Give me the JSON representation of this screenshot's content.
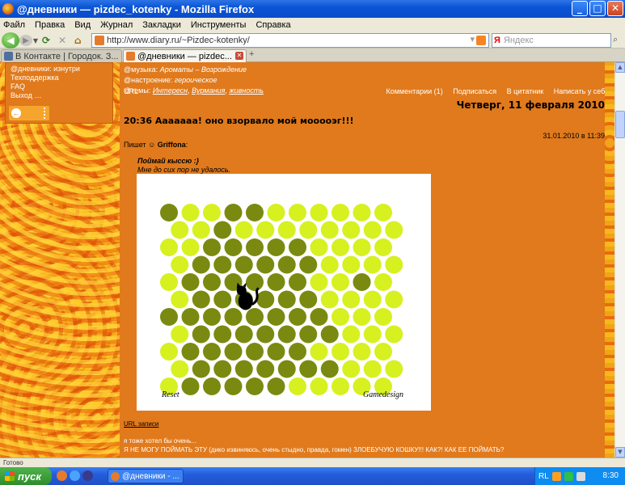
{
  "window": {
    "title": "@дневники — pizdec_kotenky - Mozilla Firefox",
    "min": "_",
    "max": "□",
    "close": "✕"
  },
  "menu": {
    "items": [
      "Файл",
      "Правка",
      "Вид",
      "Журнал",
      "Закладки",
      "Инструменты",
      "Справка"
    ]
  },
  "nav": {
    "url": "http://www.diary.ru/~Pizdec-kotenky/",
    "search_placeholder": "Яндекс",
    "search_engine": "Я"
  },
  "tabs": [
    {
      "label": "В Контакте | Городок. З..."
    },
    {
      "label": "@дневники — pizdec..."
    }
  ],
  "sidebar": {
    "items": [
      "@дневники: изнутри",
      "Техподдержка",
      "FAQ",
      "Выход"
    ],
    "exit_suffix": "…"
  },
  "post": {
    "meta_music_label": "@музыка:",
    "meta_music": "Ароматы – Возрождение",
    "meta_mood_label": "@настроение:",
    "meta_mood": "героическое",
    "meta_topics_label": "@темы:",
    "meta_topics": [
      "Интересн",
      "Вурмания",
      "живность"
    ],
    "url_label": "URL",
    "comments": "Комментарии (1)",
    "subscribe": "Подписаться",
    "quote": "В цитатник",
    "write_to_self": "Написать у себя",
    "date": "Четверг, 11 февраля 2010",
    "title": "20:36 Ааааааа! оно взорвало мой мооооэг!!!",
    "timestamp": "31.01.2010 в 11:39",
    "author_label": "Пишет",
    "author": "Griffona",
    "catch_line": "Поймай кыссю :}",
    "no_luck": "Мне до сих пор не удалось.",
    "game_reset": "Reset",
    "game_design": "Gamedesign",
    "url_link": "URL записи",
    "comment_a": "я тоже хотел бы очень...",
    "comment_b": "Я НЕ МОГУ ПОЙМАТЬ ЭТУ (дико извиняюсь, очень стыдно, правда, гомен) ЗЛОЕБУЧУЮ КОШКУ!!! КАК?! КАК ЕЕ ПОЙМАТЬ?"
  },
  "game": {
    "colors": {
      "light": "#d7f020",
      "dark": "#7a8a10",
      "cat": "#000000"
    },
    "rows": 11,
    "cols": 11,
    "dark_cells": [
      [
        0,
        0
      ],
      [
        0,
        3
      ],
      [
        0,
        4
      ],
      [
        1,
        2
      ],
      [
        2,
        2
      ],
      [
        2,
        3
      ],
      [
        2,
        4
      ],
      [
        2,
        5
      ],
      [
        2,
        6
      ],
      [
        3,
        1
      ],
      [
        3,
        2
      ],
      [
        3,
        3
      ],
      [
        3,
        4
      ],
      [
        3,
        5
      ],
      [
        3,
        6
      ],
      [
        4,
        1
      ],
      [
        4,
        2
      ],
      [
        4,
        3
      ],
      [
        4,
        4
      ],
      [
        4,
        5
      ],
      [
        4,
        6
      ],
      [
        4,
        9
      ],
      [
        5,
        1
      ],
      [
        5,
        2
      ],
      [
        5,
        3
      ],
      [
        5,
        4
      ],
      [
        5,
        5
      ],
      [
        5,
        6
      ],
      [
        6,
        0
      ],
      [
        6,
        1
      ],
      [
        6,
        2
      ],
      [
        6,
        3
      ],
      [
        6,
        4
      ],
      [
        6,
        5
      ],
      [
        6,
        6
      ],
      [
        6,
        7
      ],
      [
        7,
        1
      ],
      [
        7,
        2
      ],
      [
        7,
        3
      ],
      [
        7,
        4
      ],
      [
        7,
        5
      ],
      [
        7,
        6
      ],
      [
        7,
        7
      ],
      [
        8,
        1
      ],
      [
        8,
        2
      ],
      [
        8,
        3
      ],
      [
        8,
        4
      ],
      [
        8,
        5
      ],
      [
        8,
        6
      ],
      [
        9,
        1
      ],
      [
        9,
        2
      ],
      [
        9,
        3
      ],
      [
        9,
        4
      ],
      [
        9,
        5
      ],
      [
        9,
        6
      ],
      [
        9,
        7
      ],
      [
        10,
        1
      ],
      [
        10,
        2
      ],
      [
        10,
        3
      ],
      [
        10,
        4
      ],
      [
        10,
        5
      ]
    ],
    "cat_cell": [
      5,
      3
    ]
  },
  "statusbar": {
    "text": "Готово"
  },
  "taskbar": {
    "start": "пуск",
    "task": "@дневники - ...",
    "tray_lang": "RL",
    "clock": "8:30"
  }
}
